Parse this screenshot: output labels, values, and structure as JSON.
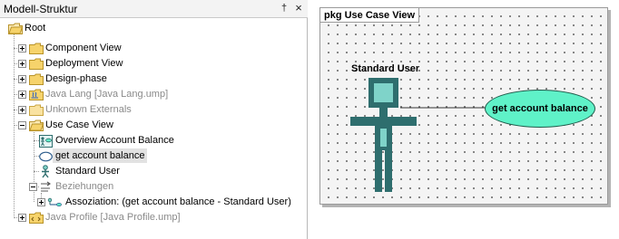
{
  "left_panel": {
    "title": "Modell-Struktur",
    "pin_glyph": "†",
    "close_glyph": "×",
    "tree": {
      "root": "Root",
      "component_view": "Component View",
      "deployment_view": "Deployment View",
      "design_phase": "Design-phase",
      "java_lang": "Java Lang [Java Lang.ump]",
      "unknown_externals": "Unknown Externals",
      "use_case_view": "Use Case View",
      "overview_account_balance": "Overview Account Balance",
      "get_account_balance": "get account balance",
      "standard_user": "Standard User",
      "beziehungen": "Beziehungen",
      "assoziation": "Assoziation:  (get account balance - Standard User)",
      "java_profile": "Java Profile [Java Profile.ump]"
    }
  },
  "diagram": {
    "package_tab": "pkg Use Case View",
    "actor_name": "Standard User",
    "use_case_label": "get account balance",
    "colors": {
      "actor": "#2e6e6e",
      "actor_head": "#7fd3c9",
      "use_case_fill": "#5ff2c8",
      "folder": "#f6d36b"
    }
  }
}
